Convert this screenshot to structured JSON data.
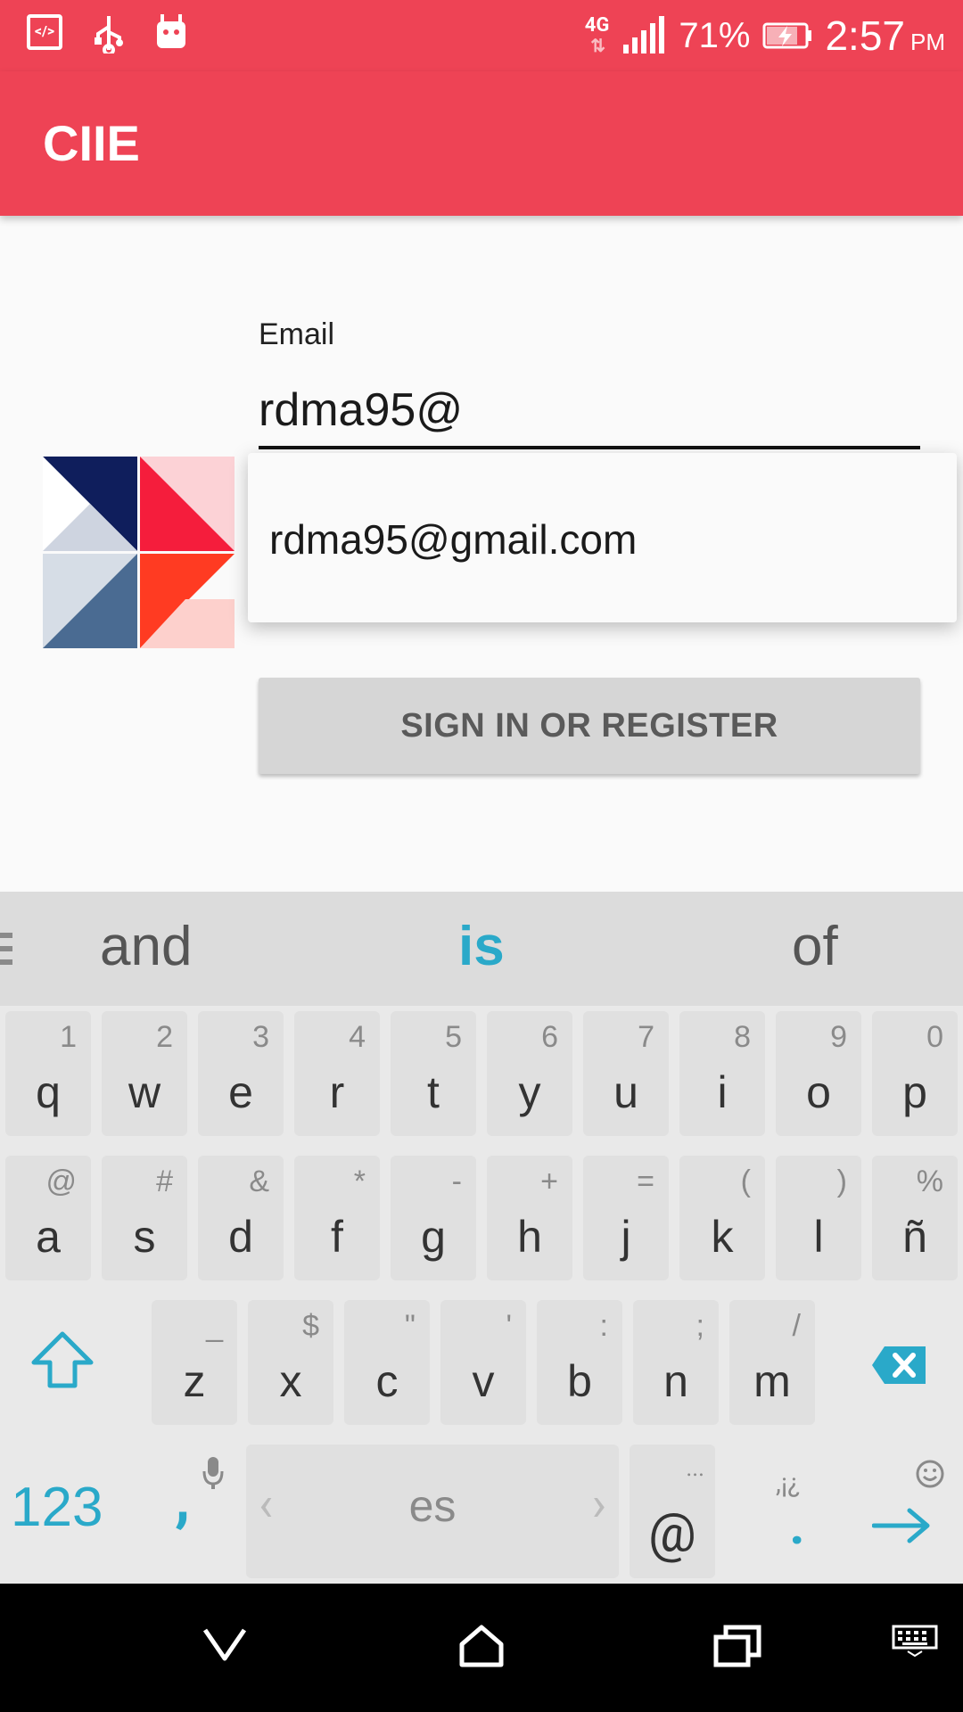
{
  "status_bar": {
    "network_type": "4G",
    "battery_percent": "71%",
    "time": "2:57",
    "ampm": "PM"
  },
  "app_bar": {
    "title": "CIIE"
  },
  "form": {
    "email_label": "Email",
    "email_value": "rdma95@",
    "autocomplete_suggestion": "rdma95@gmail.com",
    "submit_label": "SIGN IN OR REGISTER"
  },
  "keyboard": {
    "suggestions": [
      "and",
      "is",
      "of"
    ],
    "row1": [
      {
        "key": "q",
        "hint": "1"
      },
      {
        "key": "w",
        "hint": "2"
      },
      {
        "key": "e",
        "hint": "3"
      },
      {
        "key": "r",
        "hint": "4"
      },
      {
        "key": "t",
        "hint": "5"
      },
      {
        "key": "y",
        "hint": "6"
      },
      {
        "key": "u",
        "hint": "7"
      },
      {
        "key": "i",
        "hint": "8"
      },
      {
        "key": "o",
        "hint": "9"
      },
      {
        "key": "p",
        "hint": "0"
      }
    ],
    "row2": [
      {
        "key": "a",
        "hint": "@"
      },
      {
        "key": "s",
        "hint": "#"
      },
      {
        "key": "d",
        "hint": "&"
      },
      {
        "key": "f",
        "hint": "*"
      },
      {
        "key": "g",
        "hint": "-"
      },
      {
        "key": "h",
        "hint": "+"
      },
      {
        "key": "j",
        "hint": "="
      },
      {
        "key": "k",
        "hint": "("
      },
      {
        "key": "l",
        "hint": ")"
      },
      {
        "key": "ñ",
        "hint": "%"
      }
    ],
    "row3": [
      {
        "key": "z",
        "hint": "_"
      },
      {
        "key": "x",
        "hint": "$"
      },
      {
        "key": "c",
        "hint": "\""
      },
      {
        "key": "v",
        "hint": "'"
      },
      {
        "key": "b",
        "hint": ":"
      },
      {
        "key": "n",
        "hint": ";"
      },
      {
        "key": "m",
        "hint": "/"
      }
    ],
    "numbers_key": "123",
    "comma_key": ",",
    "space_language": "es",
    "at_key": "@",
    "at_hint": "...",
    "dot_key": ".",
    "dot_hint": ",¡¿",
    "accent_color": "#2aa9c9"
  },
  "colors": {
    "primary": "#ee4355",
    "logo_navy": "#0f1e5c",
    "logo_red": "#f51d3c",
    "logo_steel": "#4a6b92",
    "logo_orange": "#ff3b22"
  }
}
